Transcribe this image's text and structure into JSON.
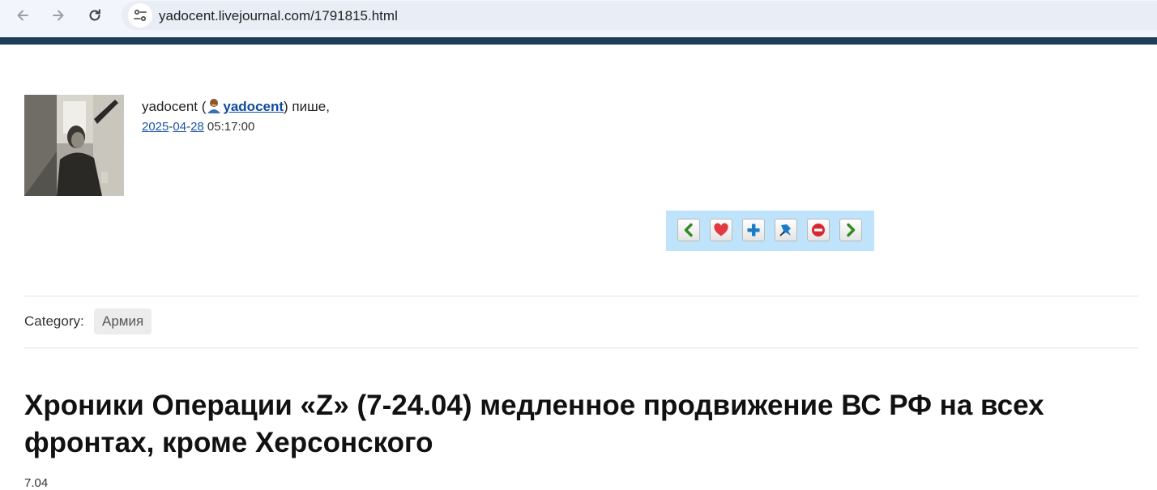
{
  "browser": {
    "url": "yadocent.livejournal.com/1791815.html",
    "back_icon": "arrow-left-icon",
    "forward_icon": "arrow-right-icon",
    "reload_icon": "reload-icon",
    "site_info_icon": "tune-icon"
  },
  "colors": {
    "topbar": "#1d3e56",
    "toolbar_bg": "#bfe3fa",
    "link": "#0f4aa0"
  },
  "post": {
    "author_prefix": "yadocent (",
    "author_user": "yadocent",
    "author_suffix": ") пише,",
    "date_year": "2025",
    "date_sep1": "-",
    "date_month": "04",
    "date_sep2": "-",
    "date_day": "28",
    "time": " 05:17:00",
    "toolbar_buttons": [
      {
        "name": "prev-entry-button",
        "icon": "chevron-left-icon"
      },
      {
        "name": "add-to-memories-button",
        "icon": "heart-icon"
      },
      {
        "name": "track-button",
        "icon": "plus-icon"
      },
      {
        "name": "tell-friend-button",
        "icon": "pin-icon"
      },
      {
        "name": "flag-button",
        "icon": "no-entry-icon"
      },
      {
        "name": "next-entry-button",
        "icon": "chevron-right-icon"
      }
    ],
    "category_label": "Category:",
    "category": "Армия",
    "title": "Хроники Операции «Z» (7-24.04) медленное продвижение ВС РФ на всех фронтах, кроме Херсонского",
    "body_start": "7.04"
  }
}
